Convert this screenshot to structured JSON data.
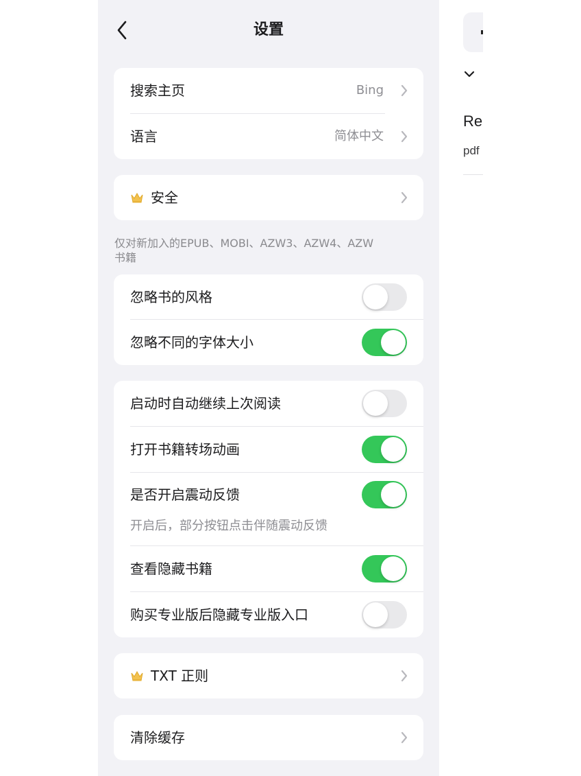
{
  "header": {
    "title": "设置"
  },
  "group_search": {
    "rows": [
      {
        "label": "搜索主页",
        "value": "Bing"
      },
      {
        "label": "语言",
        "value": "简体中文"
      }
    ]
  },
  "group_security": {
    "label": "安全"
  },
  "epub_note": {
    "line1": "仅对新加入的EPUB、MOBI、AZW3、AZW4、AZW",
    "line2": "书籍"
  },
  "group_style": {
    "rows": [
      {
        "label": "忽略书的风格",
        "on": false
      },
      {
        "label": "忽略不同的字体大小",
        "on": true
      }
    ]
  },
  "group_reading": {
    "rows": [
      {
        "label": "启动时自动继续上次阅读",
        "on": false
      },
      {
        "label": "打开书籍转场动画",
        "on": true
      },
      {
        "label": "是否开启震动反馈",
        "on": true,
        "note": "开启后，部分按钮点击伴随震动反馈"
      },
      {
        "label": "查看隐藏书籍",
        "on": true
      },
      {
        "label": "购买专业版后隐藏专业版入口",
        "on": false
      }
    ]
  },
  "group_txt": {
    "label": "TXT 正则"
  },
  "group_cache": {
    "label": "清除缓存"
  },
  "peek": {
    "text1": "Re",
    "text2": "pdf"
  },
  "colors": {
    "accent_on": "#34c759",
    "toggle_off": "#e9e9eb",
    "background": "#f2f2f6"
  },
  "icons": {
    "back": "chevron-left-icon",
    "disclosure": "chevron-right-icon",
    "pro": "crown-icon"
  }
}
